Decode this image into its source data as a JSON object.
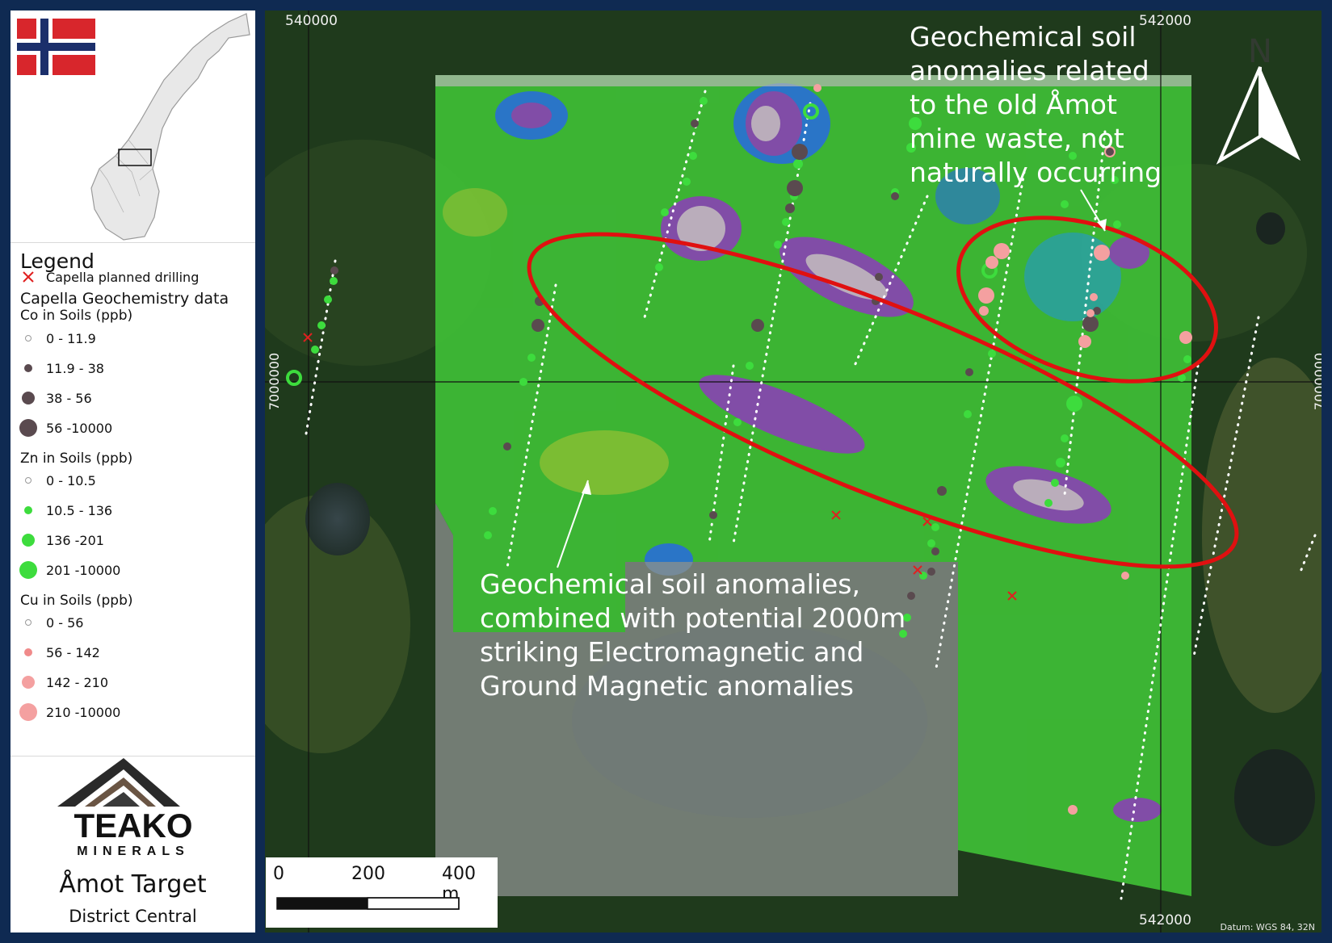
{
  "map": {
    "target_name": "Åmot Target",
    "district": "District Central",
    "datum": "Datum: WGS 84, 32N",
    "north_label": "N",
    "coords": {
      "top_left_x": "540000",
      "top_right_x": "542000",
      "bottom_right_x": "542000",
      "left_y": "7000000",
      "right_y": "7000000"
    },
    "scale_bar": {
      "label_0": "0",
      "label_200": "200",
      "label_400": "400 m"
    },
    "annotations": {
      "top": [
        "Geochemical soil",
        "anomalies related",
        "to the old Åmot",
        "mine waste, not",
        "naturally occurring"
      ],
      "bottom": [
        "Geochemical soil anomalies,",
        "combined with potential 2000m",
        "striking Electromagnetic and",
        "Ground Magnetic anomalies"
      ]
    }
  },
  "legend": {
    "title": "Legend",
    "planned_drilling": "Capella planned drilling",
    "dataset": "Capella Geochemistry data",
    "groups": [
      {
        "name": "Co in Soils (ppb)",
        "color": "#5a4a4f",
        "classes": [
          "0 - 11.9",
          "11.9 - 38",
          "38 - 56",
          "56 -10000"
        ]
      },
      {
        "name": "Zn in Soils (ppb)",
        "color": "#3ddc3d",
        "classes": [
          "0 - 10.5",
          "10.5 - 136",
          "136 -201",
          "201 -10000"
        ]
      },
      {
        "name": "Cu in Soils (ppb)",
        "color": "#f4a0a0",
        "classes": [
          "0 - 56",
          "56 - 142",
          "142 - 210",
          "210 -10000"
        ]
      }
    ]
  },
  "logo": {
    "name": "TEAKO",
    "sub": "MINERALS"
  },
  "colors": {
    "frame": "#0f2a52",
    "drill_cross": "#e02020",
    "ellipse": "#e01010",
    "co": "#5a4a4f",
    "zn": "#3ddc3d",
    "cu": "#f4a0a0"
  }
}
